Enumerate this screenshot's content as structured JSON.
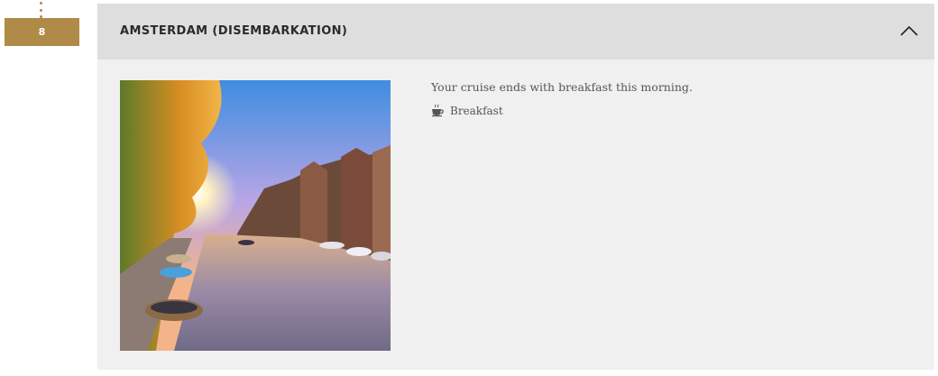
{
  "day": {
    "number": "8",
    "title": "AMSTERDAM (DISEMBARKATION)",
    "expanded": true,
    "description": "Your cruise ends with breakfast this morning.",
    "meals": [
      {
        "icon": "coffee-cup-icon",
        "label": "Breakfast"
      }
    ],
    "photo_icon": "amsterdam-canal-photo"
  },
  "colors": {
    "accent": "#b08a47",
    "header_bg": "#dedede",
    "panel_bg": "#f0f0f0",
    "text": "#555555",
    "title": "#2b2b2b"
  }
}
